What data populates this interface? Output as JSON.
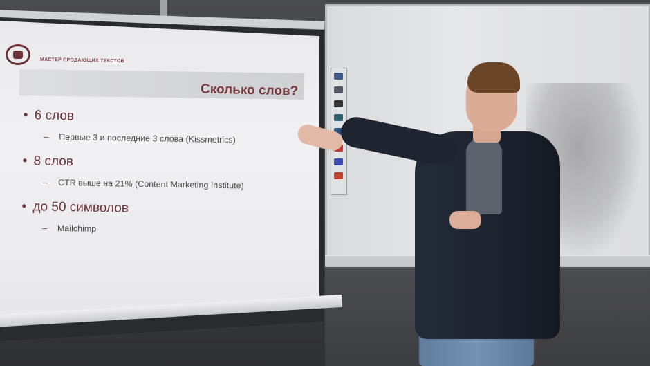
{
  "slide": {
    "brand_subtitle": "МАСТЕР ПРОДАЮЩИХ ТЕКСТОВ",
    "title": "Сколько слов?",
    "bullets": [
      {
        "text": "6 слов",
        "sub": "Первые 3 и последние 3 слова (Kissmetrics)"
      },
      {
        "text": "8 слов",
        "sub": "CTR выше на 21% (Content Marketing Institute)"
      },
      {
        "text": "до 50 символов",
        "sub": "Mailchimp"
      }
    ]
  },
  "colors": {
    "slide_title": "#7b3a3c",
    "slide_background": "#ececef",
    "jacket": "#1d2430"
  }
}
